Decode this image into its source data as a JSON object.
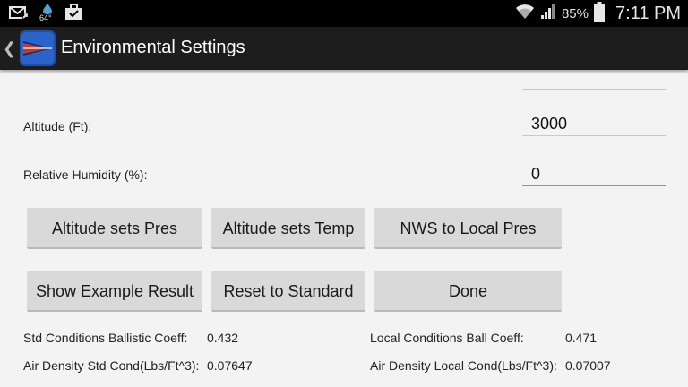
{
  "status_bar": {
    "icons_left": [
      "mail-icon",
      "weather-drop-icon",
      "briefcase-icon"
    ],
    "temperature": "64°",
    "battery_percent": "85%",
    "time": "7:11 PM"
  },
  "action_bar": {
    "title": "Environmental Settings"
  },
  "fields": {
    "top_value": "",
    "altitude": {
      "label": "Altitude (Ft):",
      "value": "3000"
    },
    "humidity": {
      "label": "Relative Humidity (%):",
      "value": "0"
    }
  },
  "buttons": {
    "altitude_sets_pres": "Altitude sets Pres",
    "altitude_sets_temp": "Altitude sets Temp",
    "nws_to_local_pres": "NWS to Local Pres",
    "show_example_result": "Show Example Result",
    "reset_to_standard": "Reset to Standard",
    "done": "Done"
  },
  "results": {
    "std_ballistic_coeff_label": "Std Conditions Ballistic Coeff:",
    "std_ballistic_coeff_value": "0.432",
    "local_ball_coeff_label": "Local Conditions Ball Coeff:",
    "local_ball_coeff_value": "0.471",
    "air_density_std_label": "Air Density Std Cond(Lbs/Ft^3):",
    "air_density_std_value": "0.07647",
    "air_density_local_label": "Air Density Local Cond(Lbs/Ft^3):",
    "air_density_local_value": "0.07007"
  },
  "colors": {
    "accent": "#33b5e5",
    "action_bar": "#1d1d1d",
    "button": "#d9d9d9",
    "background": "#f3f3f3"
  }
}
